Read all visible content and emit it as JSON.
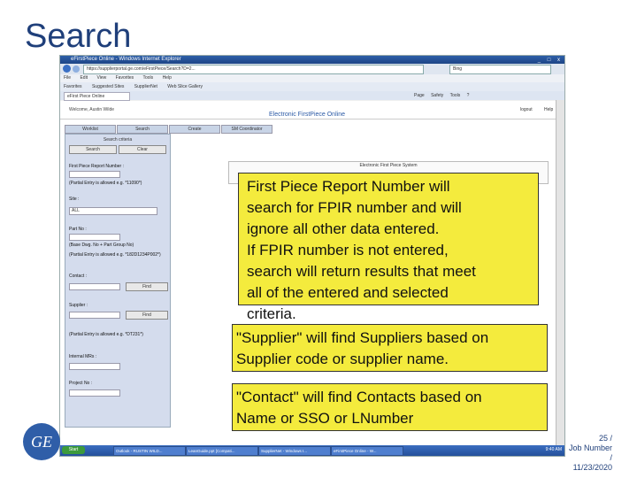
{
  "slide": {
    "title": "Search"
  },
  "browser": {
    "window_title": "eFirstPiece Online - Windows Internet Explorer",
    "window_controls": "_ □ x",
    "url": "https://supplierportal.ge.com/eFirstPiece/Search?D=2...",
    "search_placeholder": "Bing",
    "menu": [
      "File",
      "Edit",
      "View",
      "Favorites",
      "Tools",
      "Help"
    ],
    "favorites": [
      "Favorites",
      "Suggested Sites",
      "SupplierNet",
      "Web Slice Gallery"
    ],
    "tab": "eFirst Piece Online",
    "tools": [
      "Page",
      "Safety",
      "Tools",
      "?"
    ]
  },
  "app": {
    "welcome": "Welcome, Austin Wilde",
    "title": "Electronic FirstPiece Online",
    "logout": "logout",
    "help": "Help",
    "nav_tabs": [
      "Worklist",
      "Search",
      "Create",
      "SM Coordinator"
    ],
    "search_criteria": "Search criteria",
    "search_button": "Search",
    "clear_button": "Clear",
    "fpir_label": "First Piece Report Number :",
    "fpir_hint": "(Partial Entry is allowed e.g. *11090*)",
    "site_label": "Site :",
    "site_value": "ALL",
    "part_label": "Part No :",
    "part_hint1": "(Base Dwg. No + Part Group No)",
    "part_hint2": "(Partial Entry is allowed e.g. *182D1234P002*)",
    "contact_label": "Contact :",
    "find_button": "Find",
    "supplier_label": "Supplier :",
    "supplier_hint": "(Partial Entry is allowed e.g. *DT231*)",
    "internal_label": "Internal MRs :",
    "project_label": "Project No :",
    "results_header": "Electronic First Piece System"
  },
  "taskbar": {
    "start": "Start",
    "items": [
      "Outlook - RUSTIN WILD...",
      "LeanGuide.ppt [Compati...",
      "SupplierNet - Windows I...",
      "eFirstPiece Online - W..."
    ],
    "clock": "9:40 AM"
  },
  "callouts": {
    "c1": [
      "First Piece Report Number will",
      "search for FPIR number and will",
      "ignore all other data entered.",
      "If FPIR number is not entered,",
      "search will return results that meet",
      "all of the entered and selected",
      "criteria."
    ],
    "c2": [
      "\"Supplier\" will find Suppliers based on",
      "Supplier code or supplier name."
    ],
    "c3": [
      "\"Contact\" will find Contacts based on",
      "Name or SSO or LNumber"
    ]
  },
  "footer": {
    "logo_text": "GE",
    "page": "25 /",
    "job": "Job Number /",
    "date": "11/23/2020"
  },
  "colors": {
    "callout_bg": "#f4eb3d",
    "title_color": "#1f3f7a",
    "ie_blue": "#2e5fa8"
  }
}
